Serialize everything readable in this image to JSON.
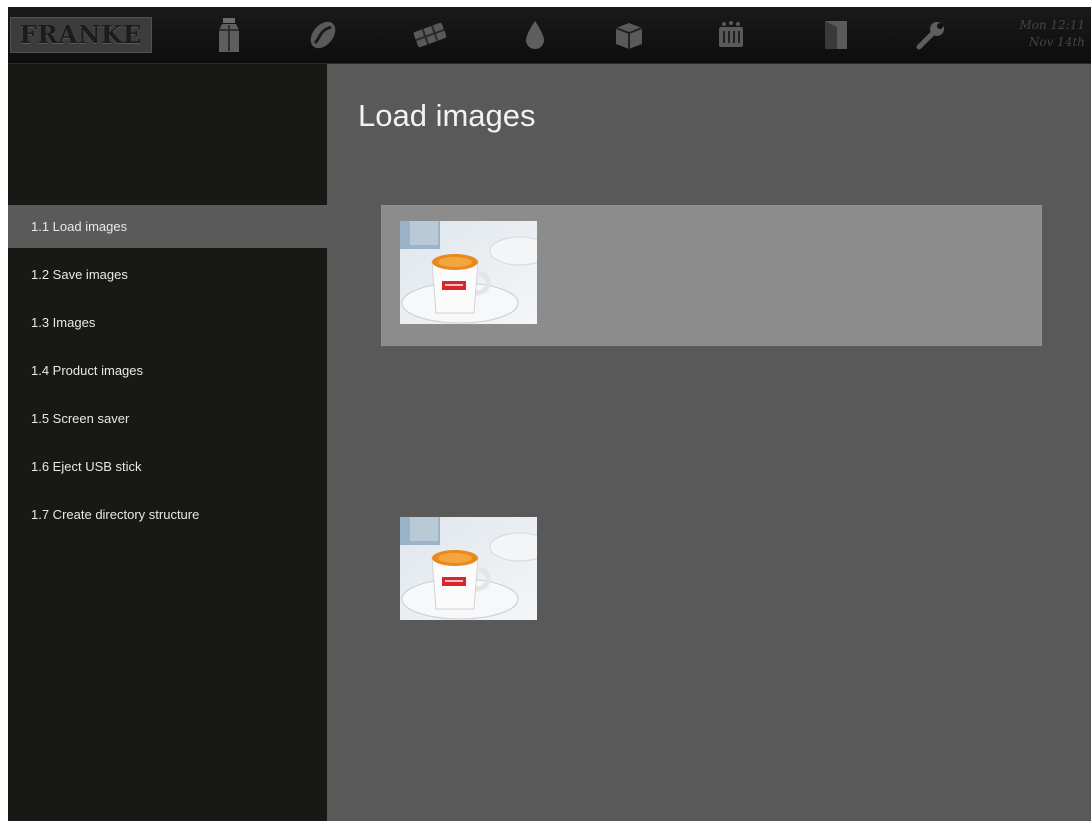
{
  "header": {
    "logo_text": "FRANKE",
    "icons": [
      {
        "name": "milk-carton-icon"
      },
      {
        "name": "coffee-bean-icon"
      },
      {
        "name": "chocolate-icon"
      },
      {
        "name": "water-drop-icon"
      },
      {
        "name": "box-icon"
      },
      {
        "name": "cleaning-icon"
      },
      {
        "name": "door-icon"
      },
      {
        "name": "wrench-icon"
      }
    ],
    "clock": {
      "time": "Mon 12:11",
      "date": "Nov 14th"
    }
  },
  "sidebar": {
    "items": [
      {
        "label": "1.1 Load images",
        "active": true
      },
      {
        "label": "1.2 Save images",
        "active": false
      },
      {
        "label": "1.3 Images",
        "active": false
      },
      {
        "label": "1.4 Product images",
        "active": false
      },
      {
        "label": "1.5 Screen saver",
        "active": false
      },
      {
        "label": "1.6 Eject USB stick",
        "active": false
      },
      {
        "label": "1.7 Create directory structure",
        "active": false
      }
    ]
  },
  "main": {
    "title": "Load images",
    "images": [
      {
        "name": "espresso-cup-image",
        "selected": true
      },
      {
        "name": "espresso-cup-image",
        "selected": false
      }
    ]
  },
  "colors": {
    "topbar": "#111111",
    "sidebar": "#181814",
    "content": "#595959",
    "active_item": "#5a5a5a",
    "selected_row": "#8c8c8c"
  }
}
